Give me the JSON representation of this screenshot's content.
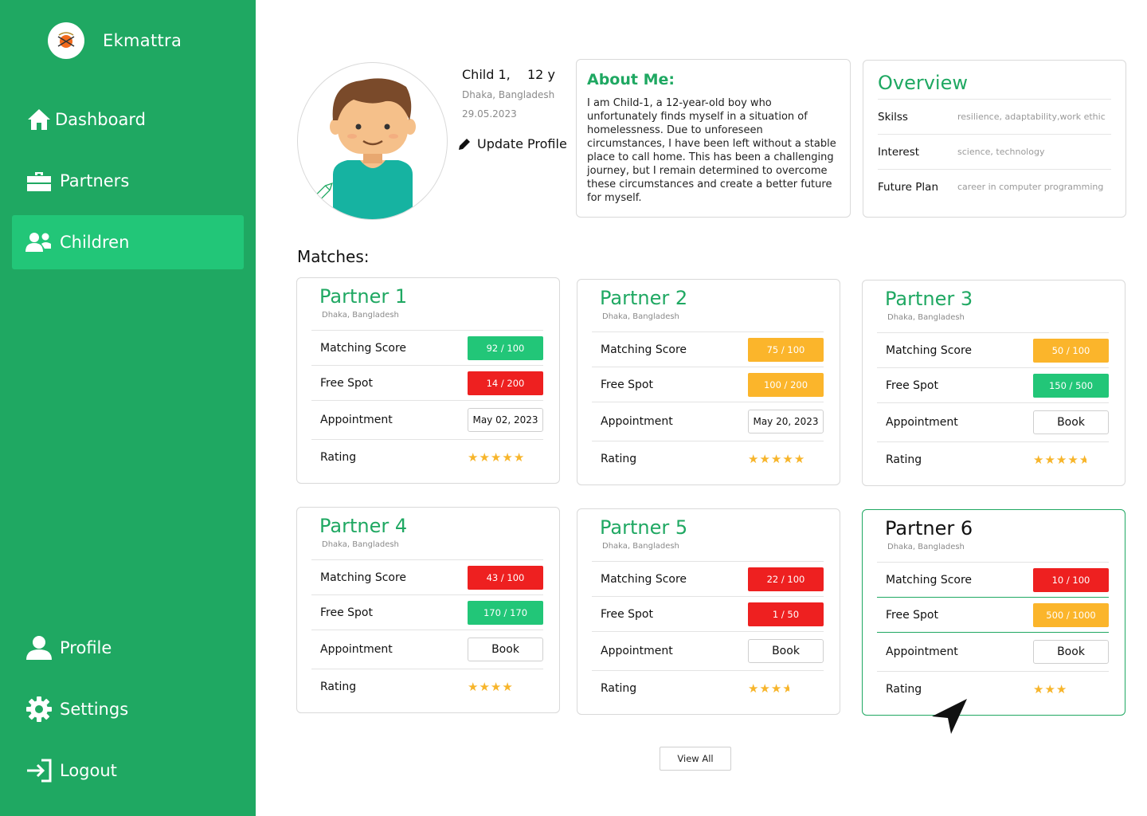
{
  "brand": {
    "name": "Ekmattra"
  },
  "nav": {
    "dashboard": "Dashboard",
    "partners": "Partners",
    "children": "Children",
    "profile": "Profile",
    "settings": "Settings",
    "logout": "Logout"
  },
  "child": {
    "name": "Child 1,",
    "age": "12 y",
    "location": "Dhaka, Bangladesh",
    "date": "29.05.2023",
    "update_label": "Update Profile"
  },
  "about": {
    "title": "About Me:",
    "text": "I am Child-1, a 12-year-old boy who unfortunately finds myself in a situation of homelessness. Due to unforeseen circumstances, I have been left without a stable place to call home. This has been a challenging journey, but I remain determined to overcome these circumstances and create a better future for myself."
  },
  "overview": {
    "title": "Overview",
    "rows": [
      {
        "key": "Skilss",
        "value": "resilience, adaptability,work ethic"
      },
      {
        "key": "Interest",
        "value": "science, technology"
      },
      {
        "key": "Future Plan",
        "value": "career in computer programming"
      }
    ]
  },
  "matches_title": "Matches:",
  "labels": {
    "matching_score": "Matching Score",
    "free_spot": "Free Spot",
    "appointment": "Appointment",
    "rating": "Rating"
  },
  "partners": [
    {
      "name": "Partner 1",
      "location": "Dhaka, Bangladesh",
      "score": "92 / 100",
      "score_color": "green",
      "spot": "14 / 200",
      "spot_color": "red",
      "appointment": "May 02, 2023",
      "appointment_type": "date",
      "rating": 5
    },
    {
      "name": "Partner 2",
      "location": "Dhaka, Bangladesh",
      "score": "75 / 100",
      "score_color": "orange",
      "spot": "100 / 200",
      "spot_color": "orange",
      "appointment": "May 20, 2023",
      "appointment_type": "date",
      "rating": 5
    },
    {
      "name": "Partner 3",
      "location": "Dhaka, Bangladesh",
      "score": "50 / 100",
      "score_color": "orange",
      "spot": "150 / 500",
      "spot_color": "green",
      "appointment": "Book",
      "appointment_type": "button",
      "rating": 4.5
    },
    {
      "name": "Partner 4",
      "location": "Dhaka, Bangladesh",
      "score": "43 / 100",
      "score_color": "red",
      "spot": "170 / 170",
      "spot_color": "green",
      "appointment": "Book",
      "appointment_type": "button",
      "rating": 4
    },
    {
      "name": "Partner 5",
      "location": "Dhaka, Bangladesh",
      "score": "22 / 100",
      "score_color": "red",
      "spot": "1 / 50",
      "spot_color": "red",
      "appointment": "Book",
      "appointment_type": "button",
      "rating": 3.5
    },
    {
      "name": "Partner 6",
      "location": "Dhaka, Bangladesh",
      "score": "10 / 100",
      "score_color": "red",
      "spot": "500 / 1000",
      "spot_color": "orange",
      "appointment": "Book",
      "appointment_type": "button",
      "rating": 3
    }
  ],
  "view_all": "View All",
  "colors": {
    "primary": "#1fa862",
    "active": "#22c678",
    "red": "#ee2020",
    "orange": "#fbb52b",
    "star": "#f7b52b"
  }
}
